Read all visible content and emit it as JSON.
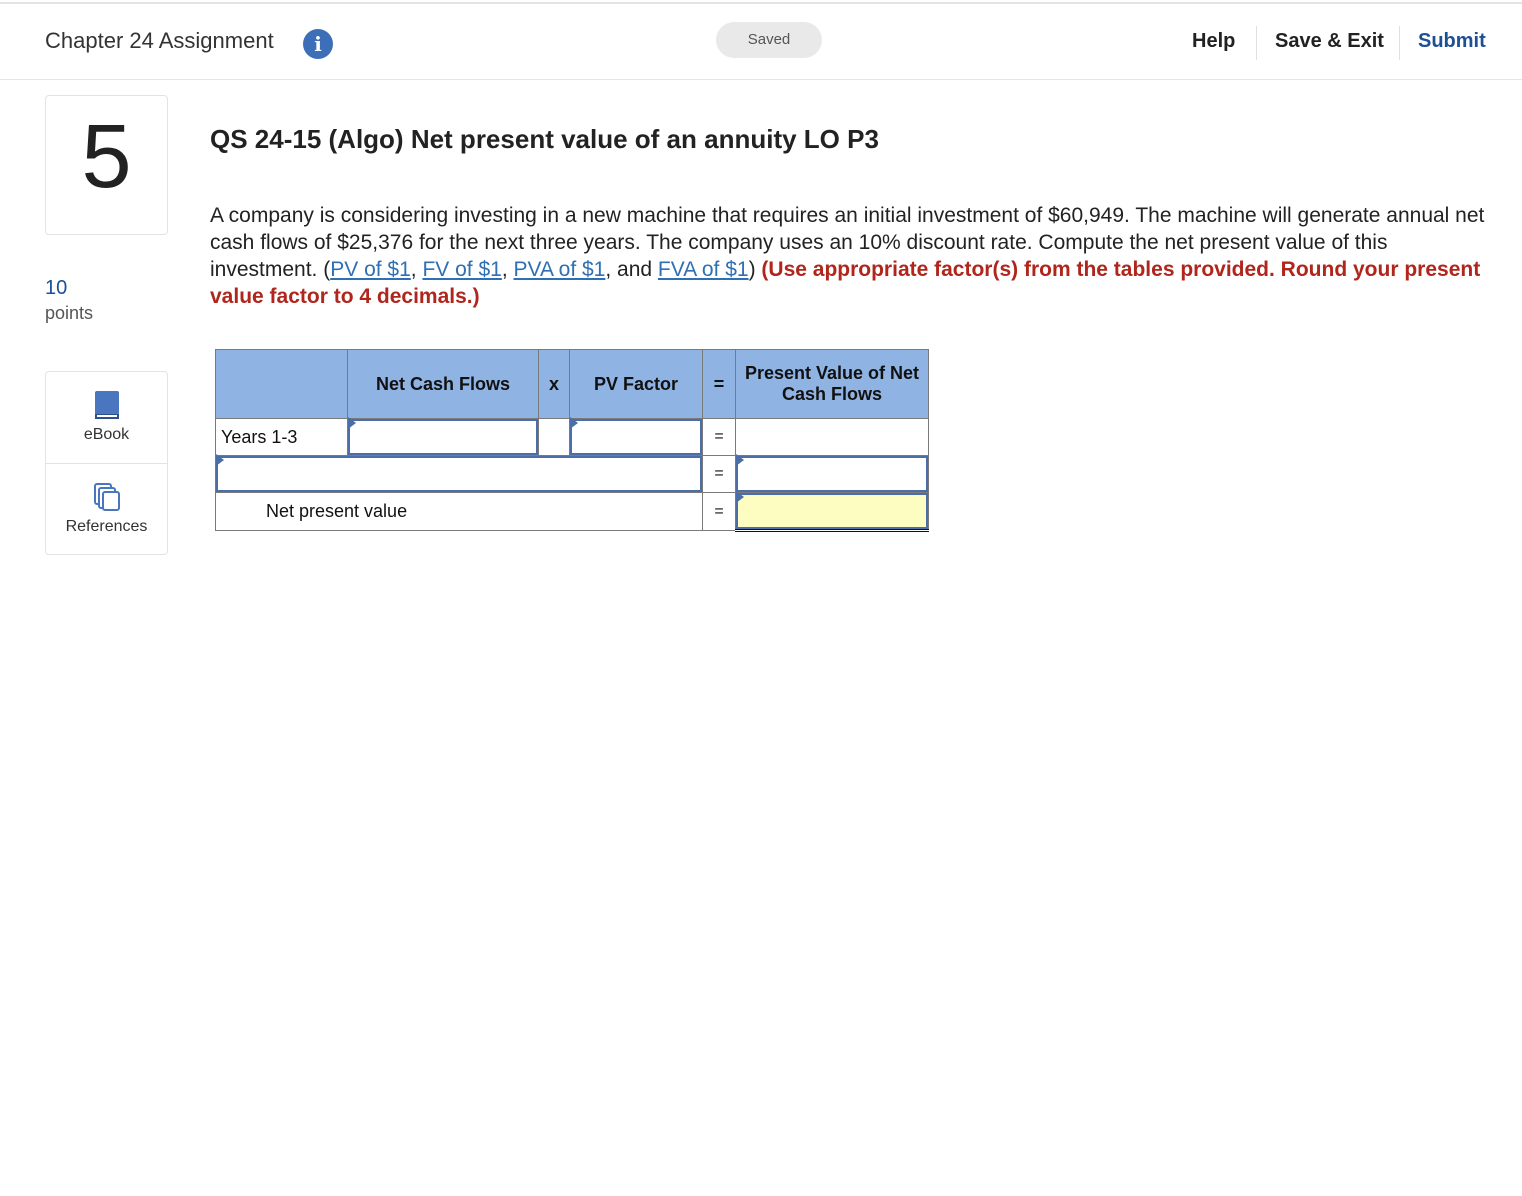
{
  "header": {
    "title": "Chapter 24 Assignment",
    "status": "Saved",
    "help_label": "Help",
    "save_exit_label": "Save & Exit",
    "submit_label": "Submit"
  },
  "sidebar": {
    "question_number": "5",
    "points_value": "10",
    "points_label": "points",
    "tools": [
      {
        "label": "eBook",
        "icon": "book-icon"
      },
      {
        "label": "References",
        "icon": "copy-icon"
      }
    ]
  },
  "question": {
    "title": "QS 24-15 (Algo) Net present value of an annuity LO P3",
    "text_1": "A company is considering investing in a new machine that requires an initial investment of $60,949. The machine will generate annual net cash flows of $25,376 for the next three years. The company uses an 10% discount rate. Compute the net present value of this investment. (",
    "link_pv": "PV of $1",
    "sep_1": ", ",
    "link_fv": "FV of $1",
    "sep_2": ", ",
    "link_pva": "PVA of $1",
    "sep_3": ", and ",
    "link_fva": "FVA of $1",
    "text_2": ") ",
    "instruction": "(Use appropriate factor(s) from the tables provided. Round your present value factor to 4 decimals.)"
  },
  "table": {
    "headers": [
      "",
      "Net Cash Flows",
      "x",
      "PV Factor",
      "=",
      "Present Value of Net Cash Flows"
    ],
    "row1_label": "Years 1-3",
    "row1_eq": "=",
    "row2_eq": "=",
    "row3_label": "Net present value",
    "row3_eq": "="
  },
  "colors": {
    "accent": "#1c4f94",
    "header_bg": "#8fb4e3",
    "input_border": "#4b6ea8",
    "highlight": "#fdfcc1",
    "instruction_red": "#b0261c"
  }
}
